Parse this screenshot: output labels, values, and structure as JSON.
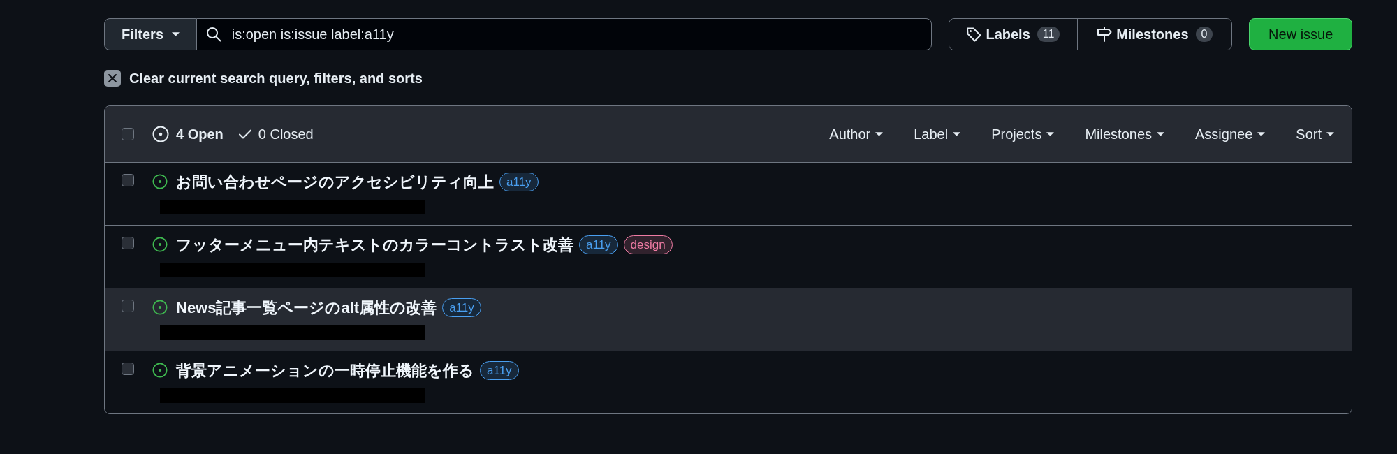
{
  "toolbar": {
    "filters_button": "Filters",
    "search": {
      "value": "is:open is:issue label:a11y"
    },
    "labels_button": {
      "label": "Labels",
      "count": "11"
    },
    "milestones_button": {
      "label": "Milestones",
      "count": "0"
    },
    "new_issue_button": "New issue"
  },
  "clear_filters": "Clear current search query, filters, and sorts",
  "issue_list": {
    "select_all": {
      "checked": false
    },
    "states": [
      {
        "kind": "open",
        "label": "4 Open",
        "selected": true
      },
      {
        "kind": "closed",
        "label": "0 Closed",
        "selected": false
      }
    ],
    "filters": [
      "Author",
      "Label",
      "Projects",
      "Milestones",
      "Assignee",
      "Sort"
    ],
    "issues": [
      {
        "title": "お問い合わせページのアクセシビリティ向上",
        "checked": false,
        "highlighted": false,
        "labels": [
          {
            "name": "a11y",
            "color": "#4a9ff0"
          }
        ]
      },
      {
        "title": "フッターメニュー内テキストのカラーコントラスト改善",
        "checked": false,
        "highlighted": false,
        "labels": [
          {
            "name": "a11y",
            "color": "#4a9ff0"
          },
          {
            "name": "design",
            "color": "#ee7ba3"
          }
        ]
      },
      {
        "title": "News記事一覧ページのalt属性の改善",
        "checked": false,
        "highlighted": true,
        "labels": [
          {
            "name": "a11y",
            "color": "#4a9ff0"
          }
        ]
      },
      {
        "title": "背景アニメーションの一時停止機能を作る",
        "checked": false,
        "highlighted": false,
        "labels": [
          {
            "name": "a11y",
            "color": "#4a9ff0"
          }
        ]
      }
    ]
  }
}
